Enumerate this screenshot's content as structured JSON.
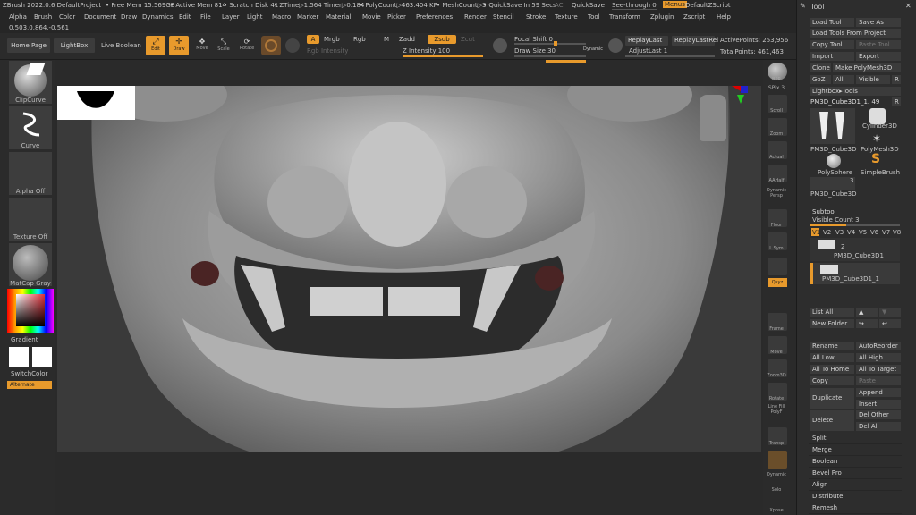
{
  "titlebar": {
    "app": "ZBrush 2022.0.6 DefaultProject",
    "free_mem": "• Free Mem 15.569GB",
    "active_mem": "• Active Mem 814",
    "scratch_disk": "• Scratch Disk 41",
    "ztime": "• ZTime▷1.564 Timer▷0.184",
    "polycount": "• PolyCount▷463.404 KP",
    "meshcount": "• MeshCount▷3",
    "quicksave_timer": "• QuickSave In 59 Secs",
    "ac": "AC",
    "quicksave": "QuickSave",
    "see_through": "See-through  0",
    "menus": "Menus",
    "default_zscript": "DefaultZScript"
  },
  "menu": [
    "Alpha",
    "Brush",
    "Color",
    "Document",
    "Draw",
    "Dynamics",
    "Edit",
    "File",
    "Layer",
    "Light",
    "Macro",
    "Marker",
    "Material",
    "Movie",
    "Picker",
    "Preferences",
    "Render",
    "Stencil",
    "Stroke",
    "Texture",
    "Tool",
    "Transform",
    "Zplugin",
    "Zscript",
    "Help"
  ],
  "coords": "0.503,0.864,-0.561",
  "toolbar": {
    "home_page": "Home Page",
    "lightbox": "LightBox",
    "live_boolean": "Live Boolean",
    "edit": "Edit",
    "draw": "Draw",
    "move": "Move",
    "scale": "Scale",
    "rotate": "Rotate",
    "a": "A",
    "mrgb": "Mrgb",
    "rgb": "Rgb",
    "m": "M",
    "zadd": "Zadd",
    "zsub": "Zsub",
    "zcut": "Zcut",
    "rgb_intensity": "Rgb Intensity",
    "z_intensity": "Z Intensity 100",
    "focal_shift": "Focal Shift 0",
    "draw_size": "Draw Size 30",
    "dynamic": "Dynamic",
    "replay_last": "ReplayLast",
    "replay_last_rel": "ReplayLastRel",
    "adjust_last": "AdjustLast 1",
    "active_points": "ActivePoints: 253,956",
    "total_points": "TotalPoints: 461,463",
    "focal_shift_value": 0.0,
    "draw_size_fraction": 0.5
  },
  "left": {
    "clipcurve": "ClipCurve",
    "curve": "Curve",
    "alpha_off": "Alpha Off",
    "texture_off": "Texture Off",
    "matcap_gray": "MatCap Gray",
    "gradient": "Gradient",
    "switch_color": "SwitchColor",
    "alternate": "Alternate"
  },
  "right_shelf": [
    {
      "name": "bpr",
      "label": "BPR"
    },
    {
      "name": "spix",
      "label": "SPix 3"
    },
    {
      "name": "scroll",
      "label": "Scroll"
    },
    {
      "name": "zoom",
      "label": "Zoom"
    },
    {
      "name": "actual",
      "label": "Actual"
    },
    {
      "name": "aahalf",
      "label": "AAHalf"
    },
    {
      "name": "dynamic-persp",
      "label": "Dynamic Persp"
    },
    {
      "name": "floor",
      "label": "Floor"
    },
    {
      "name": "lsym",
      "label": "L.Sym"
    },
    {
      "name": "lock",
      "label": ""
    },
    {
      "name": "xyz",
      "label": "Qxyz"
    },
    {
      "name": "frame",
      "label": "Frame"
    },
    {
      "name": "move",
      "label": "Move"
    },
    {
      "name": "zoom3d",
      "label": "Zoom3D"
    },
    {
      "name": "rotate",
      "label": "Rotate"
    },
    {
      "name": "linefill",
      "label": "Line Fill PolyF"
    },
    {
      "name": "transp",
      "label": "Transp"
    },
    {
      "name": "dynamic",
      "label": "Dynamic"
    },
    {
      "name": "solo",
      "label": "Solo"
    },
    {
      "name": "xpose",
      "label": "Xpose"
    }
  ],
  "tool": {
    "title": "Tool",
    "load_tool": "Load Tool",
    "save_as": "Save As",
    "load_tools_from_project": "Load Tools From Project",
    "copy_tool": "Copy Tool",
    "paste_tool": "Paste Tool",
    "import": "Import",
    "export": "Export",
    "clone": "Clone",
    "make_polymesh": "Make PolyMesh3D",
    "goz": "GoZ",
    "all": "All",
    "visible": "Visible",
    "r": "R",
    "lightbox_tools": "Lightbox▸Tools",
    "current_tool": "PM3D_Cube3D1_1. 49",
    "r2": "R",
    "thumb1": "PM3D_Cube3D",
    "thumb2": "Cylinder3D",
    "thumb3": "PolyMesh3D",
    "thumb4": "PolySphere",
    "thumb5": "SimpleBrush",
    "thumb6": "PM3D_Cube3D",
    "thumb6_count": "3",
    "subtool": "Subtool",
    "visible_count": "Visible Count 3",
    "versions": [
      "V1",
      "V2",
      "V3",
      "V4",
      "V5",
      "V6",
      "V7",
      "V8"
    ],
    "sub1_name": "PM3D_Cube3D1",
    "sub1_count": "2",
    "sub2_name": "PM3D_Cube3D1_1",
    "list_all": "List All",
    "new_folder": "New Folder",
    "rename": "Rename",
    "auto_reorder": "AutoReorder",
    "all_low": "All Low",
    "all_high": "All High",
    "all_to_home": "All To Home",
    "all_to_target": "All To Target",
    "copy": "Copy",
    "paste": "Paste",
    "duplicate": "Duplicate",
    "append": "Append",
    "insert": "Insert",
    "delete": "Delete",
    "del_other": "Del Other",
    "del_all": "Del All",
    "sections": [
      "Split",
      "Merge",
      "Boolean",
      "Bevel Pro",
      "Align",
      "Distribute",
      "Remesh"
    ]
  },
  "colors": {
    "accent": "#e89a2c",
    "bg": "#2a2a2a",
    "canvas": "#1e1e1e"
  }
}
